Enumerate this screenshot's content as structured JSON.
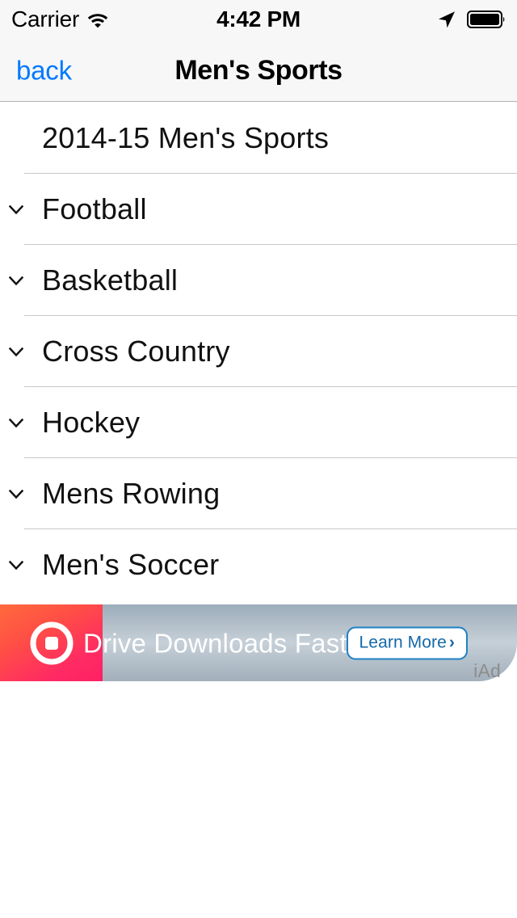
{
  "status_bar": {
    "carrier": "Carrier",
    "time": "4:42 PM",
    "wifi_icon": "wifi-icon",
    "location_icon": "location-arrow-icon",
    "battery_icon": "battery-full-icon"
  },
  "nav_bar": {
    "back_label": "back",
    "title": "Men's Sports",
    "back_color": "#007aff"
  },
  "list": {
    "rows": [
      {
        "label": "2014-15 Men's Sports",
        "has_chevron": false,
        "icon": ""
      },
      {
        "label": "Football",
        "has_chevron": true,
        "icon": "chevron-down-icon"
      },
      {
        "label": "Basketball",
        "has_chevron": true,
        "icon": "chevron-down-icon"
      },
      {
        "label": "Cross Country",
        "has_chevron": true,
        "icon": "chevron-down-icon"
      },
      {
        "label": "Hockey",
        "has_chevron": true,
        "icon": "chevron-down-icon"
      },
      {
        "label": "Mens Rowing",
        "has_chevron": true,
        "icon": "chevron-down-icon"
      },
      {
        "label": "Men's Soccer",
        "has_chevron": true,
        "icon": "chevron-down-icon"
      }
    ]
  },
  "ad_banner": {
    "headline": "Drive Downloads Faster",
    "cta_label": "Learn More",
    "cta_chevron": "›",
    "network_tag": "iAd",
    "app_icon": "target-square-icon",
    "icon_tile_color_start": "#ff6a3d",
    "icon_tile_color_end": "#ff2065",
    "cta_border_color": "#1e82c4",
    "cta_text_color": "#1468a8"
  }
}
